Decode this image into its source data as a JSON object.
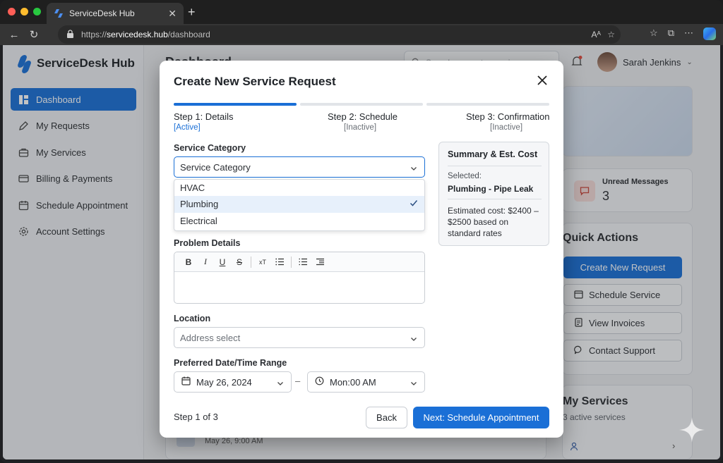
{
  "browser": {
    "tab_title": "ServiceDesk Hub",
    "url_scheme": "https://",
    "url_host": "servicedesk.hub",
    "url_path": "/dashboard",
    "traffic_colors": [
      "#ff5f57",
      "#febc2e",
      "#28c840"
    ]
  },
  "app": {
    "brand": "ServiceDesk Hub",
    "accent_color": "#1a6fd6",
    "sidebar": {
      "items": [
        {
          "label": "Dashboard",
          "icon": "dashboard-icon",
          "active": true
        },
        {
          "label": "My Requests",
          "icon": "pencil-icon",
          "active": false
        },
        {
          "label": "My Services",
          "icon": "toolbox-icon",
          "active": false
        },
        {
          "label": "Billing & Payments",
          "icon": "credit-card-icon",
          "active": false
        },
        {
          "label": "Schedule Appointment",
          "icon": "calendar-icon",
          "active": false
        },
        {
          "label": "Account Settings",
          "icon": "gear-icon",
          "active": false
        }
      ]
    },
    "header": {
      "title": "Dashboard",
      "search_placeholder": "Search requests, services",
      "user_name": "Sarah Jenkins"
    },
    "right_panel": {
      "unread_label": "Unread Messages",
      "unread_count": "3",
      "quick_actions_title": "Quick Actions",
      "quick_actions": [
        "Create New Request",
        "Schedule Service",
        "View Invoices",
        "Contact Support"
      ],
      "my_services_title": "My Services",
      "my_services_sub": "3 active services"
    },
    "background_recent": "May 26, 9:00 AM"
  },
  "modal": {
    "title": "Create New Service Request",
    "steps": [
      {
        "label": "Step 1: Details",
        "status": "[Active]"
      },
      {
        "label": "Step 2: Schedule",
        "status": "[Inactive]"
      },
      {
        "label": "Step 3: Confirmation",
        "status": "[Inactive]"
      }
    ],
    "service_category_label": "Service Category",
    "service_category_value": "Service Category",
    "category_options": [
      "HVAC",
      "Plumbing",
      "Electrical"
    ],
    "selected_option_index": 1,
    "problem_details_label": "Problem Details",
    "location_label": "Location",
    "location_placeholder": "Address select",
    "date_label": "Preferred Date/Time Range",
    "date_value": "May 26, 2024",
    "date_separator": "–",
    "time_value": "Mon:00 AM",
    "summary": {
      "title": "Summary & Est. Cost",
      "selected_label": "Selected:",
      "selected_value": "Plumbing - Pipe Leak",
      "estimate": "Estimated cost: $2400 – $2500 based on standard rates"
    },
    "footer_step": "Step 1 of 3",
    "back_label": "Back",
    "next_label": "Next: Schedule Appointment"
  }
}
